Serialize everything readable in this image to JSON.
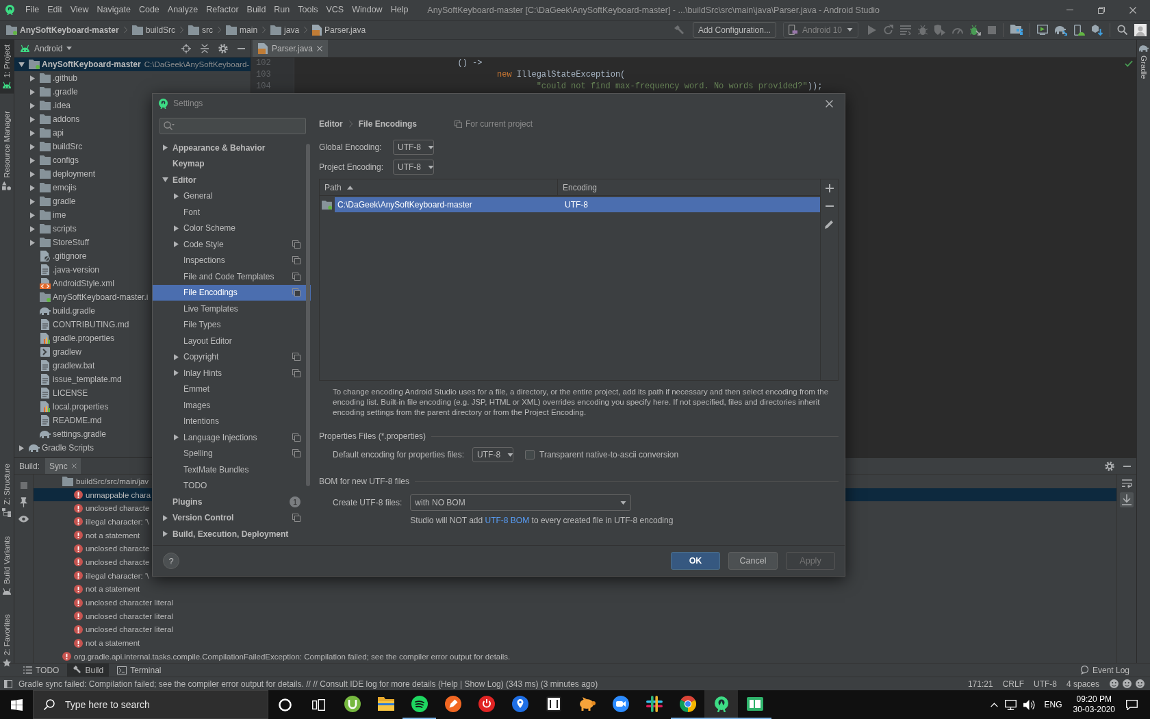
{
  "window": {
    "title": "AnySoftKeyboard-master [C:\\DaGeek\\AnySoftKeyboard-master] - ...\\buildSrc\\src\\main\\java\\Parser.java - Android Studio",
    "menu": [
      "File",
      "Edit",
      "View",
      "Navigate",
      "Code",
      "Analyze",
      "Refactor",
      "Build",
      "Run",
      "Tools",
      "VCS",
      "Window",
      "Help"
    ]
  },
  "navigation_bar": {
    "breadcrumbs": [
      {
        "label": "AnySoftKeyboard-master",
        "kind": "module"
      },
      {
        "label": "buildSrc",
        "kind": "folder"
      },
      {
        "label": "src",
        "kind": "folder"
      },
      {
        "label": "main",
        "kind": "folder"
      },
      {
        "label": "java",
        "kind": "folder"
      },
      {
        "label": "Parser.java",
        "kind": "java"
      }
    ],
    "run_configuration": "Add Configuration...",
    "device": "Android 10"
  },
  "left_stripe": {
    "top": [
      {
        "label": "1: Project",
        "kind": "project",
        "selected": true
      },
      {
        "label": "Resource Manager",
        "kind": "resources",
        "selected": false
      }
    ],
    "bottom": [
      {
        "label": "Z: Structure",
        "kind": "structure",
        "selected": false
      },
      {
        "label": "Build Variants",
        "kind": "variants",
        "selected": false
      },
      {
        "label": "2: Favorites",
        "kind": "favorites",
        "selected": false
      }
    ]
  },
  "right_stripe": [
    {
      "label": "Gradle",
      "kind": "gradle",
      "selected": false
    }
  ],
  "project_panel": {
    "view": "Android",
    "tree": [
      {
        "label": "AnySoftKeyboard-master",
        "path": "C:\\DaGeek\\AnySoftKeyboard-",
        "kind": "module",
        "expanded": true,
        "selected": true,
        "children": [
          {
            "label": ".github",
            "kind": "folder",
            "expanded": false,
            "selected": false
          },
          {
            "label": ".gradle",
            "kind": "folder",
            "expanded": false,
            "selected": false
          },
          {
            "label": ".idea",
            "kind": "folder",
            "expanded": false,
            "selected": false
          },
          {
            "label": "addons",
            "kind": "folder",
            "expanded": false,
            "selected": false
          },
          {
            "label": "api",
            "kind": "folder",
            "expanded": false,
            "selected": false
          },
          {
            "label": "buildSrc",
            "kind": "folder",
            "expanded": false,
            "selected": false
          },
          {
            "label": "configs",
            "kind": "folder",
            "expanded": false,
            "selected": false
          },
          {
            "label": "deployment",
            "kind": "folder",
            "expanded": false,
            "selected": false
          },
          {
            "label": "emojis",
            "kind": "folder",
            "expanded": false,
            "selected": false
          },
          {
            "label": "gradle",
            "kind": "folder",
            "expanded": false,
            "selected": false
          },
          {
            "label": "ime",
            "kind": "folder",
            "expanded": false,
            "selected": false
          },
          {
            "label": "scripts",
            "kind": "folder",
            "expanded": false,
            "selected": false
          },
          {
            "label": "StoreStuff",
            "kind": "folder",
            "expanded": false,
            "selected": false
          },
          {
            "label": ".gitignore",
            "kind": "ignore",
            "selected": false
          },
          {
            "label": ".java-version",
            "kind": "text",
            "selected": false
          },
          {
            "label": "AndroidStyle.xml",
            "kind": "xml",
            "selected": false
          },
          {
            "label": "AnySoftKeyboard-master.i",
            "kind": "module",
            "selected": false
          },
          {
            "label": "build.gradle",
            "kind": "gradle",
            "selected": false
          },
          {
            "label": "CONTRIBUTING.md",
            "kind": "text",
            "selected": false
          },
          {
            "label": "gradle.properties",
            "kind": "properties",
            "selected": false
          },
          {
            "label": "gradlew",
            "kind": "script",
            "selected": false
          },
          {
            "label": "gradlew.bat",
            "kind": "text",
            "selected": false
          },
          {
            "label": "issue_template.md",
            "kind": "text",
            "selected": false
          },
          {
            "label": "LICENSE",
            "kind": "text",
            "selected": false
          },
          {
            "label": "local.properties",
            "kind": "properties",
            "selected": false
          },
          {
            "label": "README.md",
            "kind": "text",
            "selected": false
          },
          {
            "label": "settings.gradle",
            "kind": "gradle",
            "selected": false
          }
        ]
      },
      {
        "label": "Gradle Scripts",
        "kind": "gradle",
        "expanded": false,
        "selected": false
      }
    ]
  },
  "editor": {
    "tabs": [
      {
        "label": "Parser.java",
        "kind": "java",
        "selected": true
      }
    ],
    "lines": [
      {
        "number": "102",
        "tokens": [
          {
            "kind": "plain",
            "text": "                                () ->"
          }
        ]
      },
      {
        "number": "103",
        "tokens": [
          {
            "kind": "keyword",
            "text": "                                        new"
          },
          {
            "kind": "plain",
            "text": " IllegalStateException("
          }
        ]
      },
      {
        "number": "104",
        "tokens": [
          {
            "kind": "string",
            "text": "                                                \"could not find max-frequency word. No words provided?\""
          },
          {
            "kind": "plain",
            "text": "));"
          }
        ]
      }
    ]
  },
  "settings_dialog": {
    "title": "Settings",
    "nav": [
      {
        "label": "Appearance & Behavior",
        "expanded": false,
        "per_project": false,
        "selected": false
      },
      {
        "label": "Keymap",
        "per_project": false,
        "selected": false
      },
      {
        "label": "Editor",
        "expanded": true,
        "per_project": false,
        "selected": false,
        "children": [
          {
            "label": "General",
            "expanded": false,
            "per_project": false,
            "selected": false
          },
          {
            "label": "Font",
            "per_project": false,
            "selected": false
          },
          {
            "label": "Color Scheme",
            "expanded": false,
            "per_project": false,
            "selected": false
          },
          {
            "label": "Code Style",
            "expanded": false,
            "per_project": true,
            "selected": false
          },
          {
            "label": "Inspections",
            "per_project": true,
            "selected": false
          },
          {
            "label": "File and Code Templates",
            "per_project": true,
            "selected": false
          },
          {
            "label": "File Encodings",
            "per_project": true,
            "selected": true
          },
          {
            "label": "Live Templates",
            "per_project": false,
            "selected": false
          },
          {
            "label": "File Types",
            "per_project": false,
            "selected": false
          },
          {
            "label": "Layout Editor",
            "per_project": false,
            "selected": false
          },
          {
            "label": "Copyright",
            "expanded": false,
            "per_project": true,
            "selected": false
          },
          {
            "label": "Inlay Hints",
            "expanded": false,
            "per_project": true,
            "selected": false
          },
          {
            "label": "Emmet",
            "per_project": false,
            "selected": false
          },
          {
            "label": "Images",
            "per_project": false,
            "selected": false
          },
          {
            "label": "Intentions",
            "per_project": false,
            "selected": false
          },
          {
            "label": "Language Injections",
            "expanded": false,
            "per_project": true,
            "selected": false
          },
          {
            "label": "Spelling",
            "per_project": true,
            "selected": false
          },
          {
            "label": "TextMate Bundles",
            "per_project": false,
            "selected": false
          },
          {
            "label": "TODO",
            "per_project": false,
            "selected": false
          }
        ]
      },
      {
        "label": "Plugins",
        "badge": "1",
        "per_project": false,
        "selected": false
      },
      {
        "label": "Version Control",
        "expanded": false,
        "per_project": true,
        "selected": false
      },
      {
        "label": "Build, Execution, Deployment",
        "expanded": false,
        "per_project": false,
        "selected": false
      }
    ],
    "page": {
      "breadcrumb": [
        "Editor",
        "File Encodings"
      ],
      "scope_note": "For current project",
      "encodings": [
        {
          "label": "Global Encoding:",
          "value": "UTF-8"
        },
        {
          "label": "Project Encoding:",
          "value": "UTF-8"
        }
      ],
      "table": {
        "columns": [
          {
            "label": "Path",
            "sorted_ascending": true
          },
          {
            "label": "Encoding"
          }
        ],
        "rows": [
          {
            "path": "C:\\DaGeek\\AnySoftKeyboard-master",
            "encoding": "UTF-8",
            "selected": true
          }
        ]
      },
      "description": "To change encoding Android Studio uses for a file, a directory, or the entire project, add its path if necessary and then select encoding from the encoding list. Built-in file encoding (e.g. JSP, HTML or XML) overrides encoding you specify here. If not specified, files and directories inherit encoding settings from the parent directory or from the Project Encoding.",
      "properties_files": {
        "title": "Properties Files (*.properties)",
        "default_encoding": {
          "label": "Default encoding for properties files:",
          "value": "UTF-8"
        },
        "native_to_ascii": {
          "label": "Transparent native-to-ascii conversion",
          "checked": false
        }
      },
      "bom": {
        "title": "BOM for new UTF-8 files",
        "create": {
          "label": "Create UTF-8 files:",
          "value": "with NO BOM"
        },
        "hint": {
          "before": "Studio will NOT add",
          "link": "UTF-8 BOM",
          "after": "to every created file in UTF-8 encoding"
        }
      }
    },
    "help": "?",
    "buttons": [
      {
        "label": "OK",
        "kind": "primary",
        "disabled": false
      },
      {
        "label": "Cancel",
        "kind": "normal",
        "disabled": false
      },
      {
        "label": "Apply",
        "kind": "normal",
        "disabled": true
      }
    ]
  },
  "build_panel": {
    "title": "Build:",
    "tabs": [
      {
        "label": "Sync",
        "selected": true
      }
    ],
    "tree": [
      {
        "kind": "folder",
        "text": "buildSrc/src/main/jav",
        "selected": false,
        "children": [
          {
            "kind": "error",
            "text": "unmappable chara",
            "selected": true
          },
          {
            "kind": "error",
            "text": "unclosed characte",
            "selected": false
          },
          {
            "kind": "error",
            "text": "illegal character: '\\",
            "selected": false
          },
          {
            "kind": "error",
            "text": "not a statement",
            "selected": false
          },
          {
            "kind": "error",
            "text": "unclosed characte",
            "selected": false
          },
          {
            "kind": "error",
            "text": "unclosed characte",
            "selected": false
          },
          {
            "kind": "error",
            "text": "illegal character: '\\",
            "selected": false
          },
          {
            "kind": "error",
            "text": "not a statement",
            "selected": false
          },
          {
            "kind": "error",
            "text": "unclosed character literal",
            "selected": false
          },
          {
            "kind": "error",
            "text": "unclosed character literal",
            "selected": false
          },
          {
            "kind": "error",
            "text": "unclosed character literal",
            "selected": false
          },
          {
            "kind": "error",
            "text": "not a statement",
            "selected": false
          }
        ]
      },
      {
        "kind": "error",
        "text": "org.gradle.api.internal.tasks.compile.CompilationFailedException: Compilation failed; see the compiler error output for details.",
        "selected": false
      }
    ]
  },
  "tool_windows": {
    "tabs": [
      {
        "label": "TODO",
        "kind": "todo",
        "selected": false
      },
      {
        "label": "Build",
        "kind": "build",
        "selected": true
      },
      {
        "label": "Terminal",
        "kind": "terminal",
        "selected": false
      }
    ],
    "event_log": "Event Log"
  },
  "status_bar": {
    "message": "Gradle sync failed: Compilation failed; see the compiler error output for details. // // Consult IDE log for more details (Help | Show Log) (343 ms) (3 minutes ago)",
    "items": [
      "171:21",
      "CRLF",
      "UTF-8",
      "4 spaces"
    ]
  },
  "taskbar": {
    "search": {
      "placeholder": "Type here to search"
    },
    "apps": [
      {
        "kind": "utorrent",
        "open": false,
        "selected": false
      },
      {
        "kind": "explorer",
        "open": false,
        "selected": false
      },
      {
        "kind": "spotify",
        "open": true,
        "selected": false
      },
      {
        "kind": "pen",
        "open": false,
        "selected": false
      },
      {
        "kind": "power",
        "open": false,
        "selected": false
      },
      {
        "kind": "pin",
        "open": false,
        "selected": false
      },
      {
        "kind": "notion",
        "open": false,
        "selected": false
      },
      {
        "kind": "pig",
        "open": false,
        "selected": false
      },
      {
        "kind": "zoom",
        "open": false,
        "selected": false
      },
      {
        "kind": "slack",
        "open": false,
        "selected": false
      },
      {
        "kind": "chrome",
        "open": true,
        "selected": false
      },
      {
        "kind": "studio",
        "open": true,
        "selected": true
      },
      {
        "kind": "columns",
        "open": true,
        "selected": false
      }
    ],
    "language": "ENG",
    "time": "09:20 PM",
    "date": "30-03-2020"
  }
}
